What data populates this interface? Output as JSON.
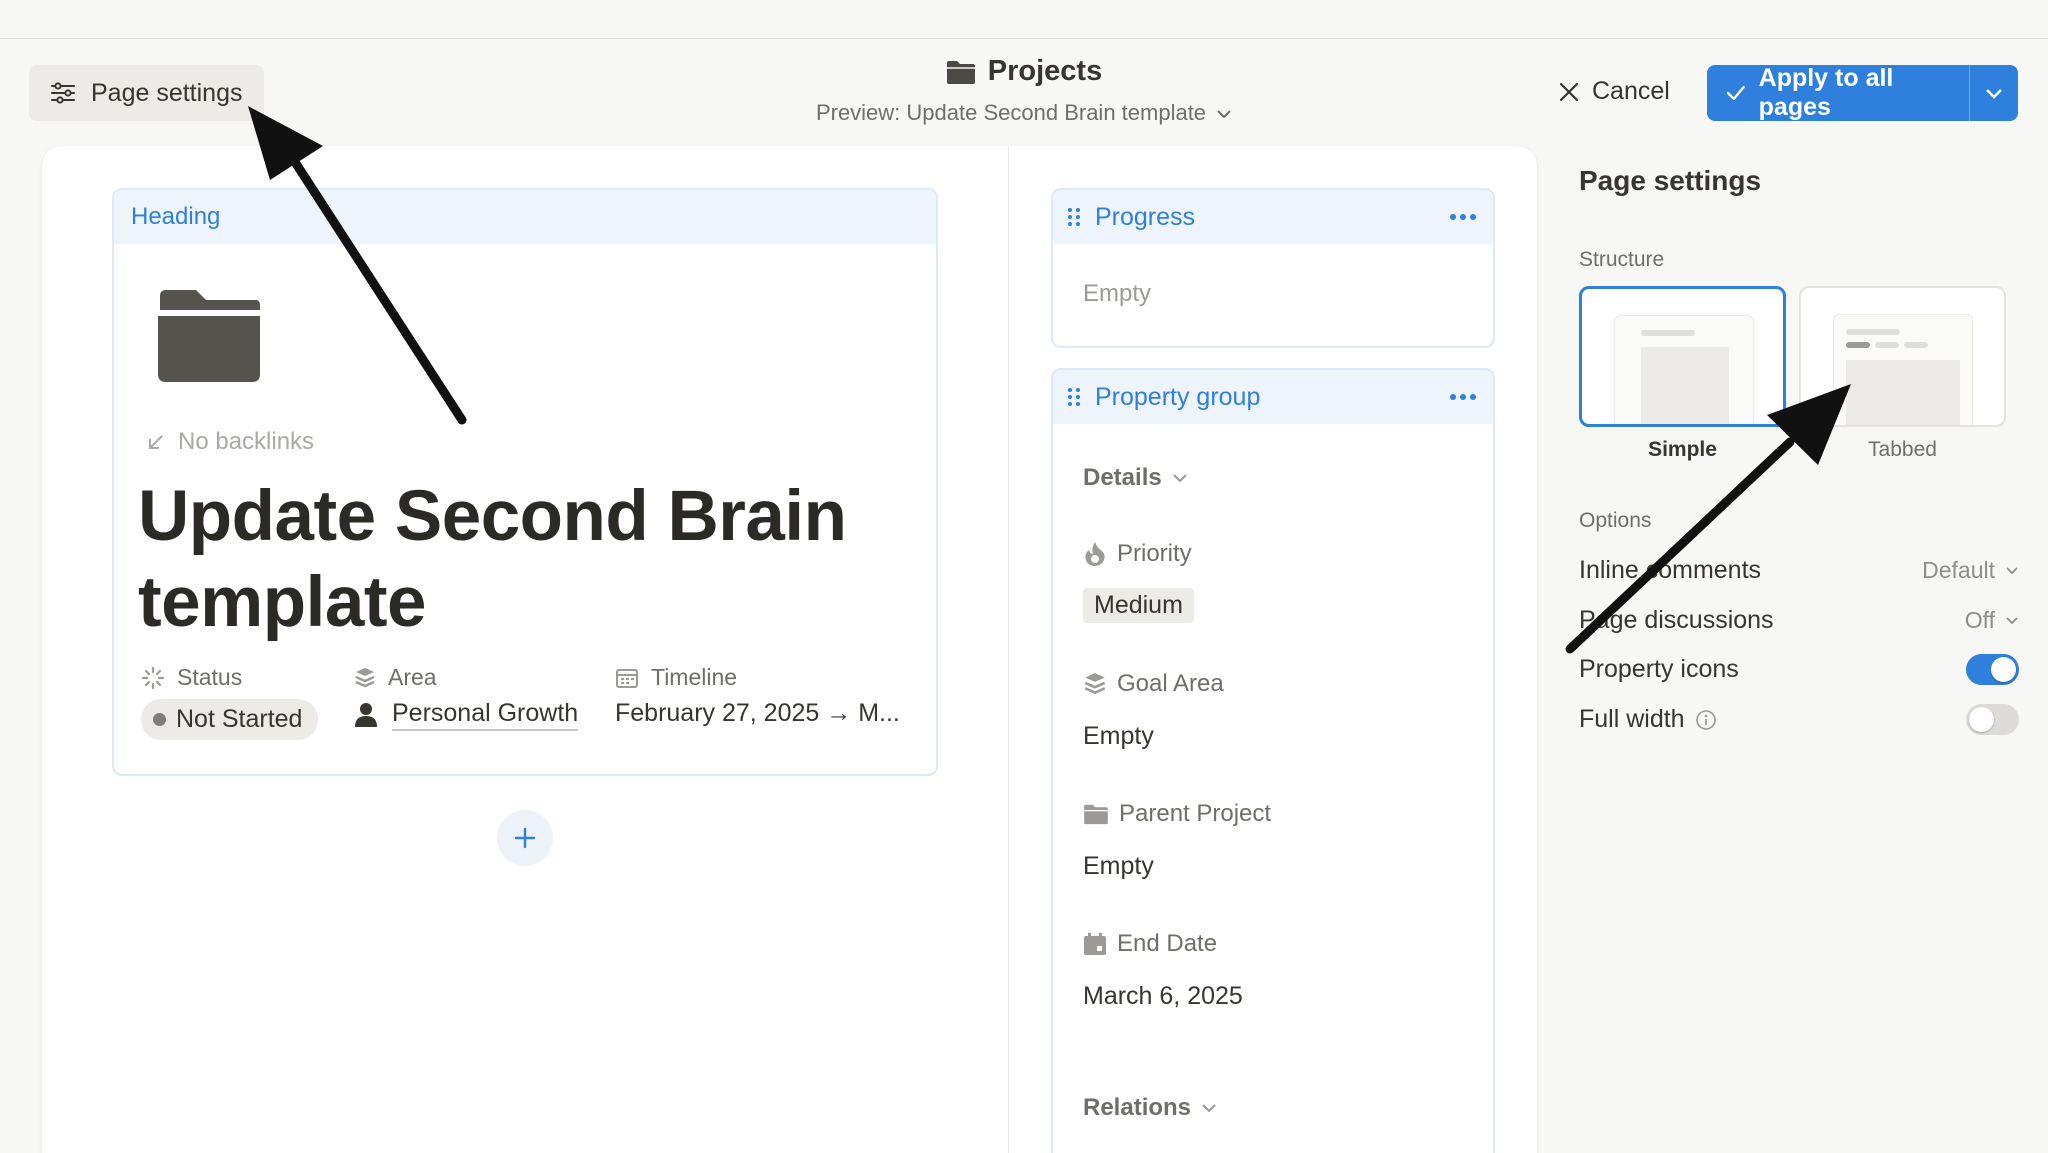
{
  "topbar": {
    "page_settings_label": "Page settings",
    "title": "Projects",
    "preview": "Preview: Update Second Brain template",
    "cancel_label": "Cancel",
    "apply_label": "Apply to all pages"
  },
  "heading_block": {
    "label": "Heading",
    "backlinks": "No backlinks",
    "page_title": "Update Second Brain template",
    "properties": [
      {
        "name": "Status",
        "value": "Not Started"
      },
      {
        "name": "Area",
        "value": "Personal Growth"
      },
      {
        "name": "Timeline",
        "value": "February 27, 2025 → M..."
      }
    ]
  },
  "progress_block": {
    "label": "Progress",
    "value": "Empty"
  },
  "property_group": {
    "label": "Property group",
    "details_label": "Details",
    "priority_label": "Priority",
    "priority_value": "Medium",
    "goal_area_label": "Goal Area",
    "goal_area_value": "Empty",
    "parent_project_label": "Parent Project",
    "parent_project_value": "Empty",
    "end_date_label": "End Date",
    "end_date_value": "March 6, 2025",
    "relations_label": "Relations"
  },
  "settings": {
    "title": "Page settings",
    "structure_label": "Structure",
    "structure_options": [
      {
        "label": "Simple",
        "selected": true
      },
      {
        "label": "Tabbed",
        "selected": false
      }
    ],
    "options_label": "Options",
    "inline_comments_label": "Inline comments",
    "inline_comments_value": "Default",
    "page_discussions_label": "Page discussions",
    "page_discussions_value": "Off",
    "property_icons_label": "Property icons",
    "property_icons_on": true,
    "full_width_label": "Full width",
    "full_width_on": false
  },
  "colors": {
    "accent": "#2f80dc",
    "heading_bg": "#eef4fc",
    "text": "#37352f",
    "muted": "#9b9a97"
  }
}
